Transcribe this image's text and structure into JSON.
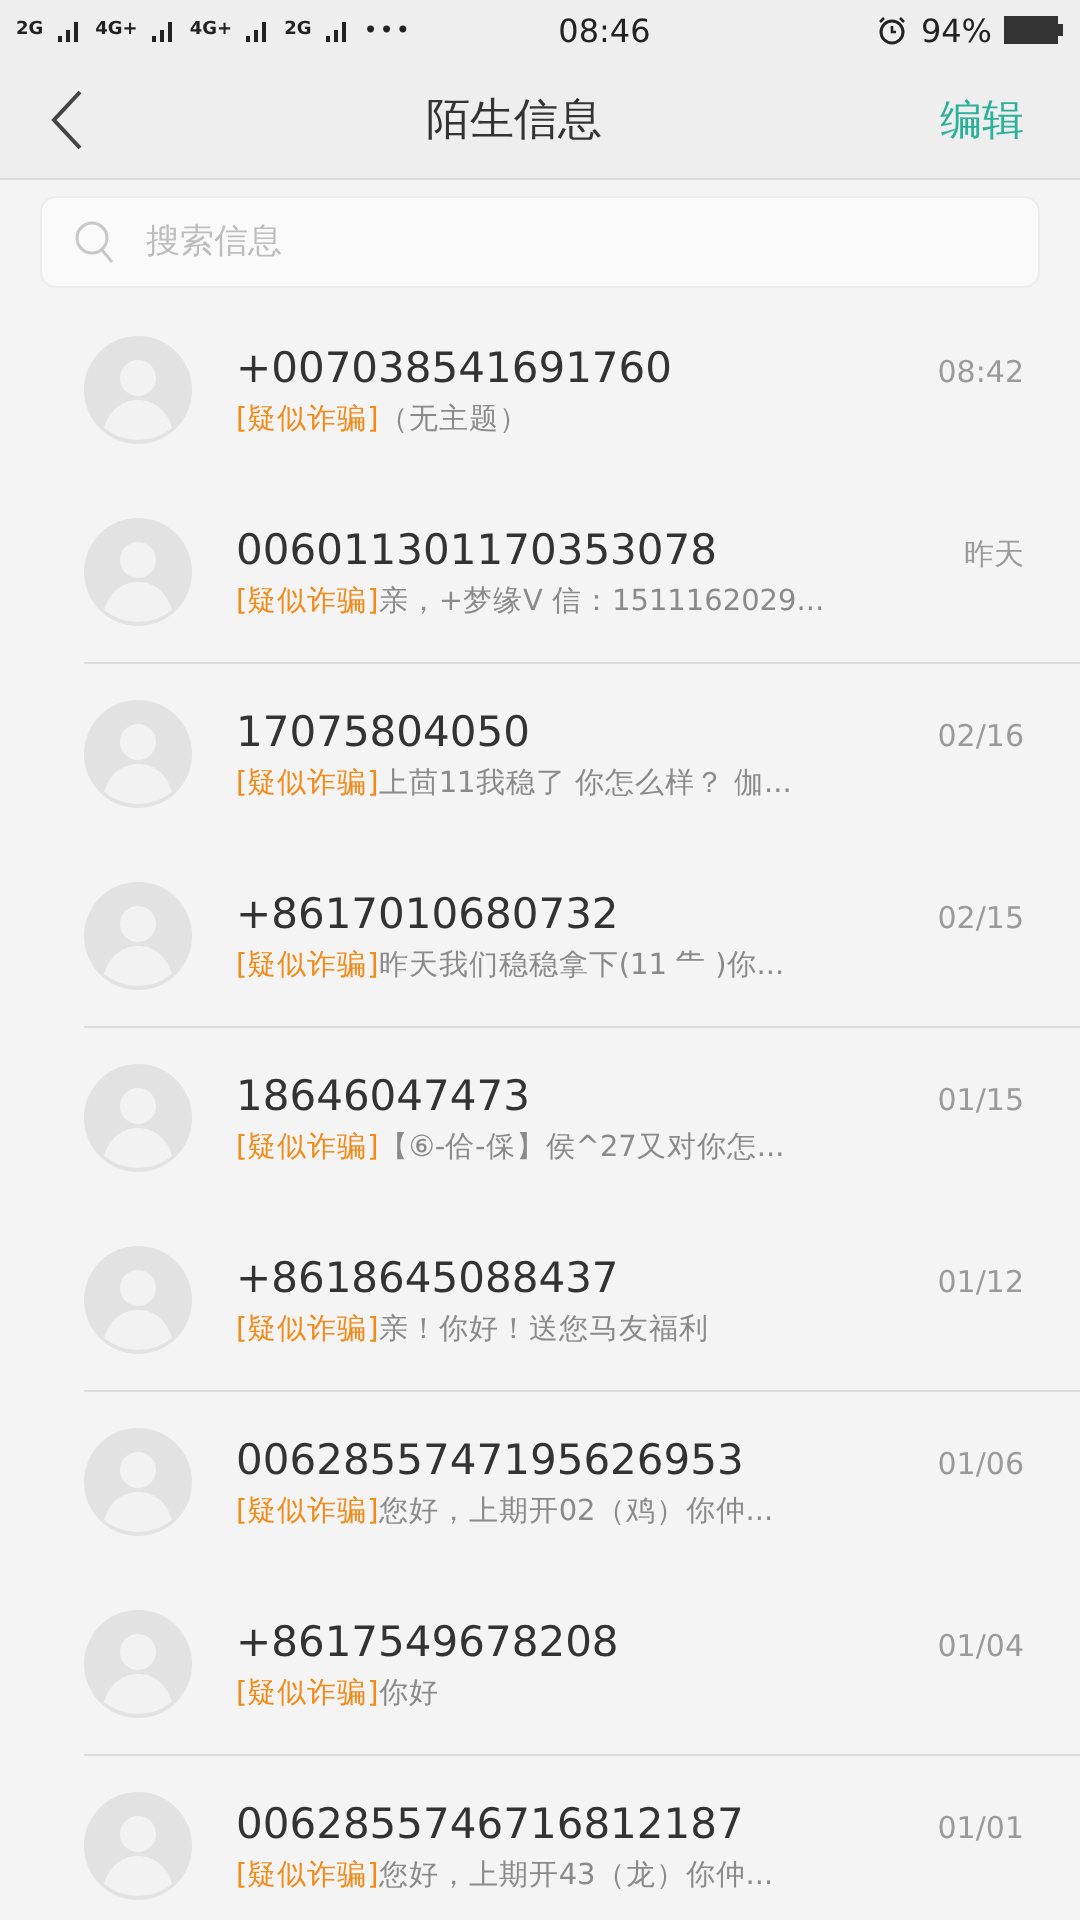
{
  "status_bar": {
    "networks": [
      "2G",
      "4G+",
      "4G+",
      "2G"
    ],
    "more": "•••",
    "time": "08:46",
    "battery": "94%"
  },
  "nav": {
    "title": "陌生信息",
    "action": "编辑"
  },
  "search": {
    "placeholder": "搜索信息"
  },
  "messages": [
    {
      "sender": "+007038541691760",
      "tag": "[疑似诈骗]",
      "preview": "（无主题）",
      "time": "08:42",
      "divider_below": false
    },
    {
      "sender": "006011301170353078",
      "tag": "[疑似诈骗]",
      "preview": "亲，+梦缘V 信：1511162029...",
      "time": "昨天",
      "divider_below": true
    },
    {
      "sender": "17075804050",
      "tag": "[疑似诈骗]",
      "preview": "上茴11我稳了 你怎么样？ 伽...",
      "time": "02/16",
      "divider_below": false
    },
    {
      "sender": "+8617010680732",
      "tag": "[疑似诈骗]",
      "preview": "昨天我们稳稳拿下(11 ⺧ )你...",
      "time": "02/15",
      "divider_below": true
    },
    {
      "sender": "18646047473",
      "tag": "[疑似诈骗]",
      "preview": "【⑥-佮-倸】侯^27又对你怎...",
      "time": "01/15",
      "divider_below": false
    },
    {
      "sender": "+8618645088437",
      "tag": "[疑似诈骗]",
      "preview": "亲！你好！送您马友福利",
      "time": "01/12",
      "divider_below": true
    },
    {
      "sender": "0062855747195626953",
      "tag": "[疑似诈骗]",
      "preview": "您好，上期开02（鸡）你仲...",
      "time": "01/06",
      "divider_below": false
    },
    {
      "sender": "+8617549678208",
      "tag": "[疑似诈骗]",
      "preview": "你好",
      "time": "01/04",
      "divider_below": true
    },
    {
      "sender": "0062855746716812187",
      "tag": "[疑似诈骗]",
      "preview": "您好，上期开43（龙）你仲...",
      "time": "01/01",
      "divider_below": false
    }
  ]
}
